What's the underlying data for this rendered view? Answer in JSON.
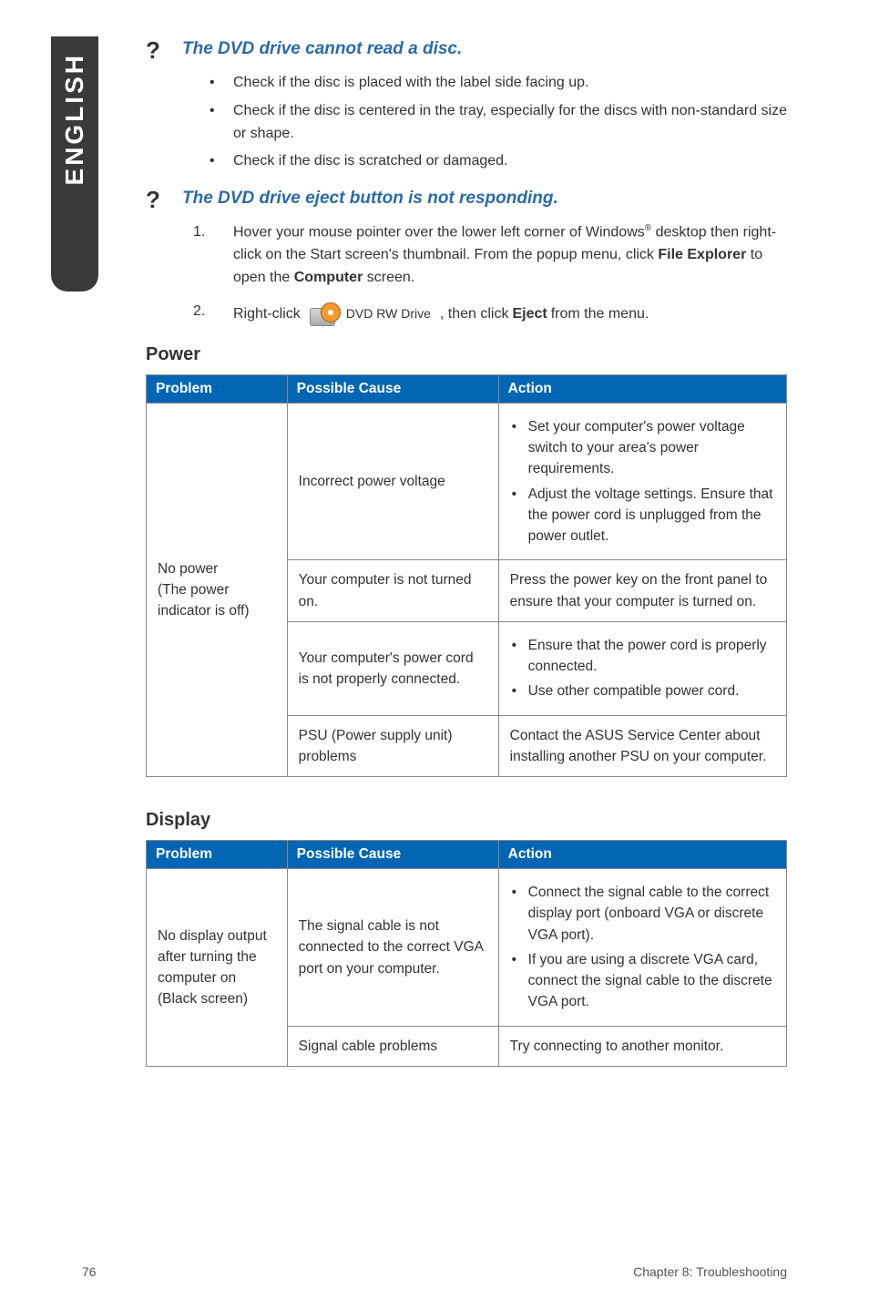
{
  "sidebar": {
    "label": "ENGLISH"
  },
  "q1": {
    "title": "The DVD drive cannot read a disc.",
    "bullets": [
      "Check if the disc is placed with the label side facing up.",
      "Check if the disc is centered in the tray, especially for the discs with non-standard size or shape.",
      "Check if the disc is scratched or damaged."
    ]
  },
  "q2": {
    "title": "The DVD drive eject button is not responding.",
    "step1": {
      "num": "1.",
      "pre": "Hover your mouse pointer over the lower left corner of Windows",
      "sup": "®",
      "post": " desktop then right-click on the Start screen's thumbnail. From the popup menu, click ",
      "bold1": "File Explorer",
      "mid": " to open the ",
      "bold2": "Computer",
      "tail": " screen."
    },
    "step2": {
      "num": "2.",
      "pre": "Right-click ",
      "icon_label": "DVD RW Drive",
      "mid": ", then click ",
      "bold": "Eject",
      "tail": " from the menu."
    }
  },
  "power": {
    "heading": "Power",
    "headers": {
      "problem": "Problem",
      "cause": "Possible Cause",
      "action": "Action"
    },
    "problem": "No power\n(The power indicator is off)",
    "rows": [
      {
        "cause": "Incorrect power voltage",
        "actions": [
          "Set your computer's power voltage switch to your area's power requirements.",
          "Adjust the voltage settings. Ensure that the power cord is unplugged from the power outlet."
        ]
      },
      {
        "cause": "Your computer is not turned on.",
        "action_plain": "Press the power key on the front panel to ensure that your computer is turned on."
      },
      {
        "cause": "Your computer's power cord is not properly connected.",
        "actions": [
          "Ensure that the power cord is properly connected.",
          "Use other compatible power cord."
        ]
      },
      {
        "cause": "PSU (Power supply unit) problems",
        "action_plain": "Contact the ASUS Service Center about installing another PSU on your computer."
      }
    ]
  },
  "display": {
    "heading": "Display",
    "headers": {
      "problem": "Problem",
      "cause": "Possible Cause",
      "action": "Action"
    },
    "problem": "No display output after turning the computer on (Black screen)",
    "rows": [
      {
        "cause": "The signal cable is not connected to the correct VGA port on your computer.",
        "actions": [
          "Connect the signal cable to the correct display port (onboard VGA or discrete VGA port).",
          "If you are using a discrete VGA card, connect the signal cable to the discrete VGA port."
        ]
      },
      {
        "cause": "Signal cable problems",
        "action_plain": "Try connecting to another monitor."
      }
    ]
  },
  "footer": {
    "page": "76",
    "chapter": "Chapter 8: Troubleshooting"
  }
}
